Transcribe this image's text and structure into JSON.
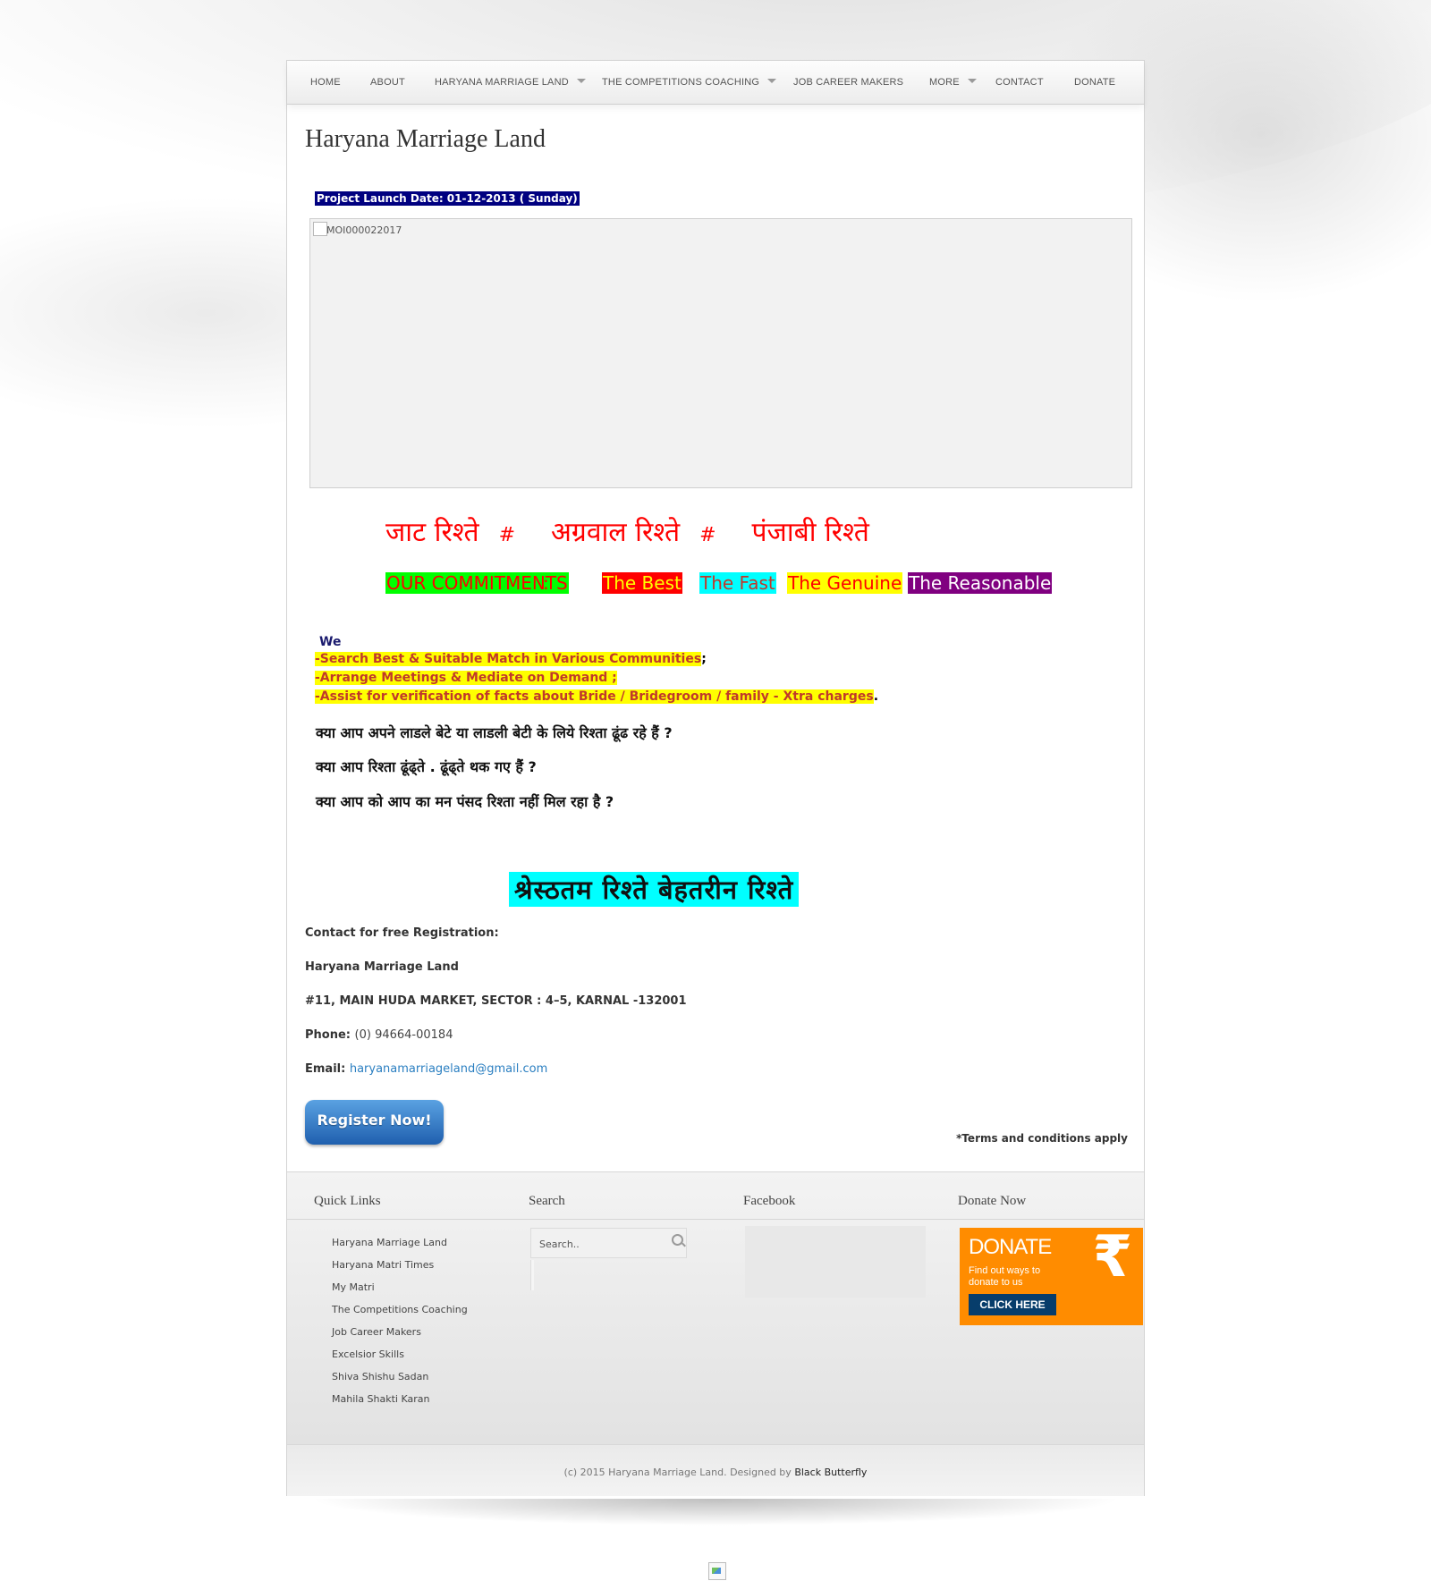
{
  "nav": {
    "items": [
      {
        "label": "HOME"
      },
      {
        "label": "ABOUT"
      },
      {
        "label": "HARYANA MARRIAGE LAND"
      },
      {
        "label": "THE COMPETITIONS COACHING"
      },
      {
        "label": "JOB CAREER MAKERS"
      },
      {
        "label": "MORE"
      },
      {
        "label": "CONTACT"
      },
      {
        "label": "DONATE"
      }
    ]
  },
  "page": {
    "title": "Haryana Marriage Land",
    "launch_date": "Project Launch Date:  01-12-2013   ( Sunday)",
    "iframe_text": "MOI000022017",
    "hindi_heading": {
      "part1": "जाट  रिश्ते",
      "hash1": "#",
      "part2": "अग्रवाल  रिश्ते",
      "hash2": "#",
      "part3": "पंजाबी  रिश्ते"
    },
    "commitments": {
      "label": "OUR COMMITMENTS",
      "colon": ":",
      "items": [
        {
          "text": "The Best",
          "bg": "#ff0000",
          "color": "#ffff00"
        },
        {
          "text": "The Fast",
          "bg": "#00ffff",
          "color": "#c0392b"
        },
        {
          "text": "The Genuine",
          "bg": "#ffff00",
          "color": "#ff0000"
        },
        {
          "text": "The Reasonable",
          "bg": "#800080",
          "color": "#ffffff"
        }
      ],
      "label_bg": "#00ff00",
      "label_color": "#ff0000"
    },
    "we": {
      "label": "We",
      "lines": [
        {
          "text": "-Search  Best  &  Suitable   Match  in Various Communities",
          "tail": ";"
        },
        {
          "text": "-Arrange  Meetings  &  Mediate  on Demand ;",
          "tail": ""
        },
        {
          "text": "-Assist  for  verification of  facts  about   Bride / Bridegroom / family - Xtra charges",
          "tail": "."
        }
      ]
    },
    "questions": [
      "क्या आप अपने लाडले बेटे या लाडली   बेटी के लिये रिश्ता ढूंढ रहे हैं  ?",
      "क्या आप रिश्ता ढूंढ्ते .  ढूंढ्ते   थक गए  हैं   ?",
      "क्या आप को आप का मन पंसद रिश्ता नहीं मिल रहा है     ?"
    ],
    "shrest_banner": "श्रेस्ठतम   रिश्ते   बेहतरीन   रिश्ते",
    "contact": {
      "intro": "Contact for free Registration:",
      "org": "Haryana Marriage Land",
      "address": "#11, MAIN HUDA MARKET, SECTOR :  4–5, KARNAL -132001",
      "phone_label": "Phone:",
      "phone": "(0) 94664-00184",
      "email_label": "Email:",
      "email": "haryanamarriageland@gmail.com"
    },
    "register_button": "Register Now!",
    "terms": "*Terms and conditions apply"
  },
  "footer": {
    "quick_links_heading": "Quick Links",
    "quick_links": [
      "Haryana Marriage Land",
      "Haryana Matri Times",
      "My Matri",
      "The Competitions Coaching",
      "Job Career Makers",
      "Excelsior Skills",
      "Shiva Shishu Sadan",
      "Mahila Shakti Karan"
    ],
    "search_heading": "Search",
    "search_placeholder": "Search..",
    "facebook_heading": "Facebook",
    "donate_heading": "Donate Now",
    "donate_banner": {
      "title": "DONATE",
      "subtitle": "Find out ways to donate to us",
      "symbol": "₹",
      "button": "CLICK HERE"
    },
    "copyright": "(c) 2015 Haryana Marriage Land. Designed by ",
    "designer": "Black Butterfly"
  }
}
